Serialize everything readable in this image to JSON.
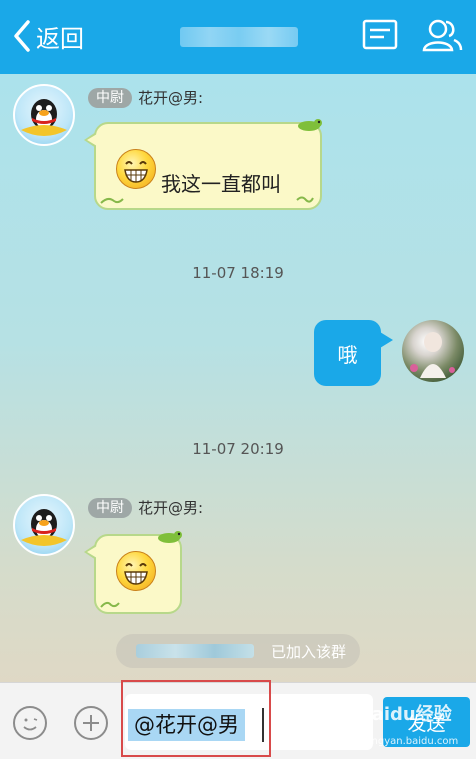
{
  "header": {
    "back_label": "返回",
    "title_obscured": true,
    "accent_color": "#1aa8e8"
  },
  "messages": [
    {
      "side": "received",
      "rank": "中尉",
      "sender": "花开@男:",
      "emoji": "grin-emoji",
      "text": "我这一直都叫"
    },
    {
      "type": "timestamp",
      "text": "11-07 18:19"
    },
    {
      "side": "sent",
      "text": "哦"
    },
    {
      "type": "timestamp",
      "text": "11-07 20:19"
    },
    {
      "side": "received",
      "rank": "中尉",
      "sender": "花开@男:",
      "emoji": "grin-emoji",
      "text": ""
    }
  ],
  "system_notice": {
    "text": "已加入该群"
  },
  "input": {
    "value": "@花开@男",
    "send_label": "发送"
  },
  "watermark": {
    "brand": "Baidu经验",
    "url": "jingyan.baidu.com"
  }
}
